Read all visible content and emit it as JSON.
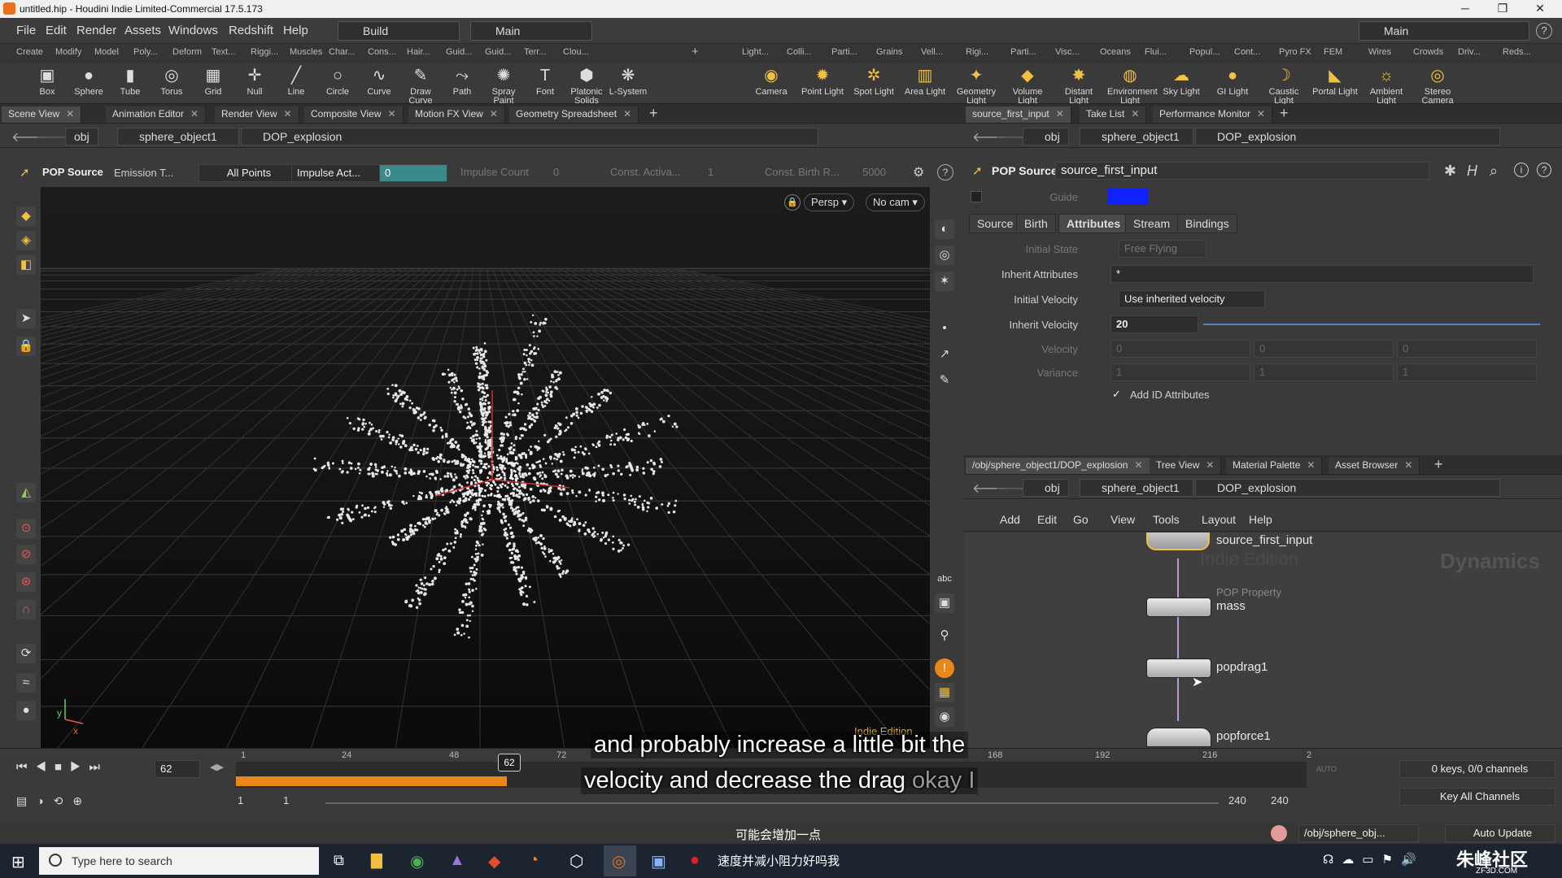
{
  "titlebar": {
    "title": "untitled.hip - Houdini Indie Limited-Commercial 17.5.173",
    "min": "─",
    "max": "❐",
    "close": "✕"
  },
  "menubar": {
    "items": [
      "File",
      "Edit",
      "Render",
      "Assets",
      "Windows",
      "Redshift",
      "Help"
    ],
    "desktop_left": "Build",
    "desktop_right_left": "Main",
    "desktop_right": "Main"
  },
  "shelf_tabs_left": [
    "Create",
    "Modify",
    "Model",
    "Poly...",
    "Deform",
    "Text...",
    "Riggi...",
    "Muscles",
    "Char...",
    "Cons...",
    "Hair...",
    "Guid...",
    "Guid...",
    "Terr...",
    "Clou..."
  ],
  "shelf_tabs_right": [
    "Light...",
    "Colli...",
    "Parti...",
    "Grains",
    "Vell...",
    "Rigi...",
    "Parti...",
    "Visc...",
    "Oceans",
    "Flui...",
    "Popul...",
    "Cont...",
    "Pyro FX",
    "FEM",
    "Wires",
    "Crowds",
    "Driv...",
    "Reds..."
  ],
  "tools_left": [
    {
      "label": "Box",
      "icon": "▣"
    },
    {
      "label": "Sphere",
      "icon": "●"
    },
    {
      "label": "Tube",
      "icon": "▮"
    },
    {
      "label": "Torus",
      "icon": "◎"
    },
    {
      "label": "Grid",
      "icon": "▦"
    },
    {
      "label": "Null",
      "icon": "✛"
    },
    {
      "label": "Line",
      "icon": "╱"
    },
    {
      "label": "Circle",
      "icon": "○"
    },
    {
      "label": "Curve",
      "icon": "∿"
    },
    {
      "label": "Draw Curve",
      "icon": "✎"
    },
    {
      "label": "Path",
      "icon": "⤳"
    },
    {
      "label": "Spray Paint",
      "icon": "✺"
    },
    {
      "label": "Font",
      "icon": "T"
    },
    {
      "label": "Platonic Solids",
      "icon": "⬢"
    },
    {
      "label": "L-System",
      "icon": "❋"
    }
  ],
  "tools_right": [
    {
      "label": "Camera",
      "icon": "◉"
    },
    {
      "label": "Point Light",
      "icon": "✹"
    },
    {
      "label": "Spot Light",
      "icon": "✲"
    },
    {
      "label": "Area Light",
      "icon": "▥"
    },
    {
      "label": "Geometry Light",
      "icon": "✦"
    },
    {
      "label": "Volume Light",
      "icon": "◆"
    },
    {
      "label": "Distant Light",
      "icon": "✸"
    },
    {
      "label": "Environment Light",
      "icon": "◍"
    },
    {
      "label": "Sky Light",
      "icon": "☁"
    },
    {
      "label": "GI Light",
      "icon": "●"
    },
    {
      "label": "Caustic Light",
      "icon": "☽"
    },
    {
      "label": "Portal Light",
      "icon": "◣"
    },
    {
      "label": "Ambient Light",
      "icon": "☼"
    },
    {
      "label": "Stereo Camera",
      "icon": "◎"
    }
  ],
  "left_panel": {
    "tabs": [
      "Scene View",
      "Animation Editor",
      "Render View",
      "Composite View",
      "Motion FX View",
      "Geometry Spreadsheet"
    ],
    "path": {
      "root": "obj",
      "obj": "sphere_object1",
      "node": "DOP_explosion"
    },
    "op": {
      "type": "POP Source",
      "emission_label": "Emission T...",
      "emission_value": "All Points",
      "impulse_act": "Impulse Act...",
      "impulse_value": "0",
      "impulse_count": "Impulse Count",
      "impulse_count_val": "0",
      "const_act": "Const. Activa...",
      "const_act_val": "1",
      "const_birth": "Const. Birth R...",
      "const_birth_val": "5000"
    },
    "view": {
      "persp": "Persp ▾",
      "cam": "No cam ▾",
      "watermark": "Indie Edition",
      "axis_y": "y",
      "axis_x": "x"
    }
  },
  "right_top": {
    "tabs": [
      "source_first_input",
      "Take List",
      "Performance Monitor"
    ],
    "path": {
      "root": "obj",
      "obj": "sphere_object1",
      "node": "DOP_explosion"
    },
    "op_type": "POP Source",
    "op_name": "source_first_input",
    "guide_label": "Guide",
    "guide_color": "#1020ff",
    "param_tabs": [
      "Source",
      "Birth",
      "Attributes",
      "Stream",
      "Bindings"
    ],
    "params": {
      "initial_state_label": "Initial State",
      "initial_state": "Free Flying",
      "inherit_attr_label": "Inherit Attributes",
      "inherit_attr": "*",
      "initial_vel_label": "Initial Velocity",
      "initial_vel": "Use inherited velocity",
      "inherit_vel_label": "Inherit Velocity",
      "inherit_vel": "20",
      "velocity_label": "Velocity",
      "velocity": [
        "0",
        "0",
        "0"
      ],
      "variance_label": "Variance",
      "variance": [
        "1",
        "1",
        "1"
      ],
      "add_id_label": "Add ID Attributes"
    }
  },
  "right_bottom": {
    "tabs": [
      "/obj/sphere_object1/DOP_explosion",
      "Tree View",
      "Material Palette",
      "Asset Browser"
    ],
    "path": {
      "root": "obj",
      "obj": "sphere_object1",
      "node": "DOP_explosion"
    },
    "menu": [
      "Add",
      "Edit",
      "Go",
      "View",
      "Tools",
      "Layout",
      "Help"
    ],
    "watermark": "Indie Edition",
    "context": "Dynamics",
    "nodes": [
      {
        "name": "source_first_input",
        "type": ""
      },
      {
        "name": "mass",
        "type": "POP Property"
      },
      {
        "name": "popdrag1",
        "type": ""
      },
      {
        "name": "popforce1",
        "type": ""
      }
    ]
  },
  "timeline": {
    "frame": "62",
    "current_marker": "62",
    "ticks": [
      "1",
      "24",
      "48",
      "72",
      "168",
      "192",
      "216",
      "2"
    ],
    "start": "1",
    "start2": "1",
    "end": "240",
    "end2": "240",
    "keys": "0 keys, 0/0 channels",
    "key_all": "Key All Channels",
    "auto": "AUTO"
  },
  "subtitles": {
    "line1": "and probably increase a little bit the",
    "line2a": "velocity and decrease the drag ",
    "line2b": "okay I",
    "chinese": "可能会增加一点"
  },
  "statusbar": {
    "path": "/obj/sphere_obj...",
    "update": "Auto Update"
  },
  "taskbar": {
    "search": "Type here to search",
    "notification": "速度并减小阻力好吗我",
    "brand": "朱峰社区",
    "brand_sub": "ZF3D.COM"
  },
  "colors": {
    "accent_orange": "#e8871a",
    "impulse_teal": "#3a8a8a",
    "wire": "#b89bd6",
    "node_yellow": "#f0c040"
  }
}
